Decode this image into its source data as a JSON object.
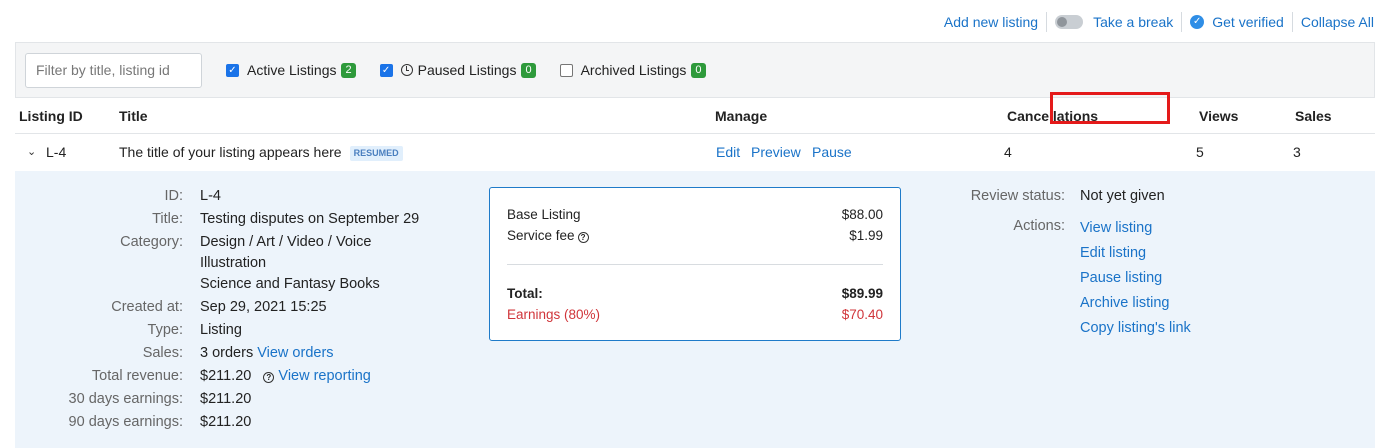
{
  "topbar": {
    "add_new_listing": "Add new listing",
    "take_a_break": "Take a break",
    "get_verified": "Get verified",
    "collapse_all": "Collapse All"
  },
  "filters": {
    "search_placeholder": "Filter by title, listing id",
    "active_label": "Active Listings",
    "active_count": "2",
    "paused_label": "Paused Listings",
    "paused_count": "0",
    "archived_label": "Archived Listings",
    "archived_count": "0"
  },
  "table": {
    "headers": [
      "Listing ID",
      "Title",
      "Manage",
      "Cancellations",
      "Views",
      "Sales"
    ],
    "row": {
      "id": "L-4",
      "title": "The title of your listing appears here",
      "status": "RESUMED",
      "manage": [
        "Edit",
        "Preview",
        "Pause"
      ],
      "cancellations": "4",
      "views": "5",
      "sales": "3"
    }
  },
  "details": {
    "id_label": "ID:",
    "id": "L-4",
    "title_label": "Title:",
    "title": "Testing disputes on September 29",
    "category_label": "Category:",
    "category_lines": [
      "Design / Art / Video / Voice",
      "Illustration",
      "Science and Fantasy Books"
    ],
    "created_label": "Created at:",
    "created": "Sep 29, 2021 15:25",
    "type_label": "Type:",
    "type": "Listing",
    "sales_label": "Sales:",
    "sales": "3 orders",
    "view_orders": "View orders",
    "revenue_label": "Total revenue:",
    "revenue": "$211.20",
    "view_reporting": "View reporting",
    "e30_label": "30 days earnings:",
    "e30": "$211.20",
    "e90_label": "90 days earnings:",
    "e90": "$211.20"
  },
  "pricing": {
    "base_label": "Base Listing",
    "base": "$88.00",
    "fee_label": "Service fee",
    "fee": "$1.99",
    "total_label": "Total:",
    "total": "$89.99",
    "earnings_label": "Earnings (80%)",
    "earnings": "$70.40"
  },
  "review": {
    "status_label": "Review status:",
    "status": "Not yet given",
    "actions_label": "Actions:",
    "actions": [
      "View listing",
      "Edit listing",
      "Pause listing",
      "Archive listing",
      "Copy listing's link"
    ]
  },
  "colors": {
    "link": "#1a73c8",
    "highlight": "#e41a1a",
    "badge": "#2e9a3b",
    "earnings": "#d0353a"
  }
}
